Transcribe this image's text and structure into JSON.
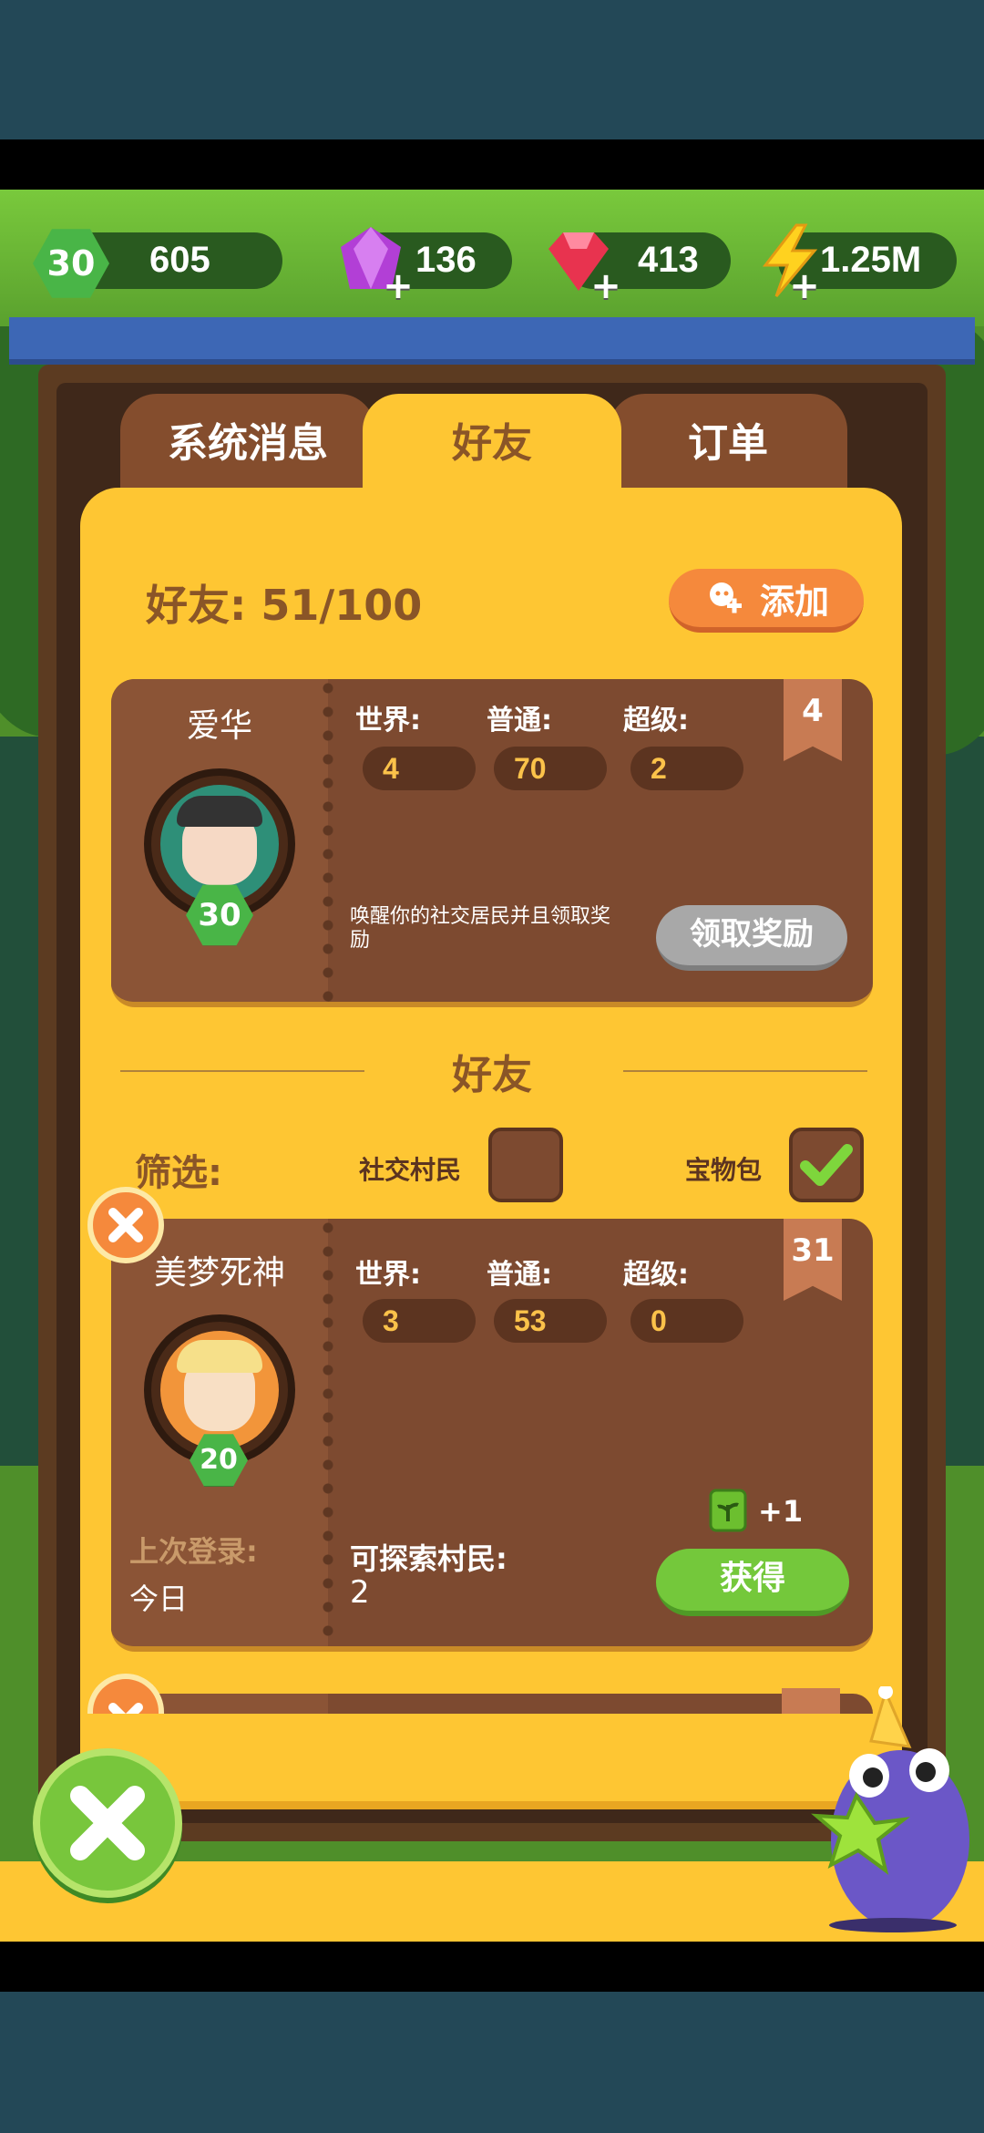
{
  "resources": {
    "level": "30",
    "xp": "605",
    "gems": "136",
    "rubies": "413",
    "energy": "1.25M"
  },
  "tabs": {
    "system": "系统消息",
    "friends": "好友",
    "orders": "订单"
  },
  "friends_header": {
    "count_label": "好友: 51/100",
    "add_label": "添加"
  },
  "me_card": {
    "name": "爱华",
    "level": "30",
    "world_label": "世界:",
    "normal_label": "普通:",
    "super_label": "超级:",
    "world": "4",
    "normal": "70",
    "super": "2",
    "rank": "4",
    "hint": "唤醒你的社交居民并且领取奖励",
    "claim_label": "领取奖励"
  },
  "section_title": "好友",
  "filter": {
    "label": "筛选:",
    "social": "社交村民",
    "treasure": "宝物包",
    "social_checked": false,
    "treasure_checked": true
  },
  "friend_card": {
    "name": "美梦死神",
    "level": "20",
    "world_label": "世界:",
    "normal_label": "普通:",
    "super_label": "超级:",
    "world": "3",
    "normal": "53",
    "super": "0",
    "rank": "31",
    "last_login_label": "上次登录:",
    "last_login": "今日",
    "explorable_label": "可探索村民:",
    "explorable": "2",
    "reward": "+1",
    "get_label": "获得"
  },
  "colors": {
    "panel": "#fec633",
    "card": "#7d4a30",
    "accent_orange": "#f5893c",
    "accent_green": "#74c83b"
  }
}
